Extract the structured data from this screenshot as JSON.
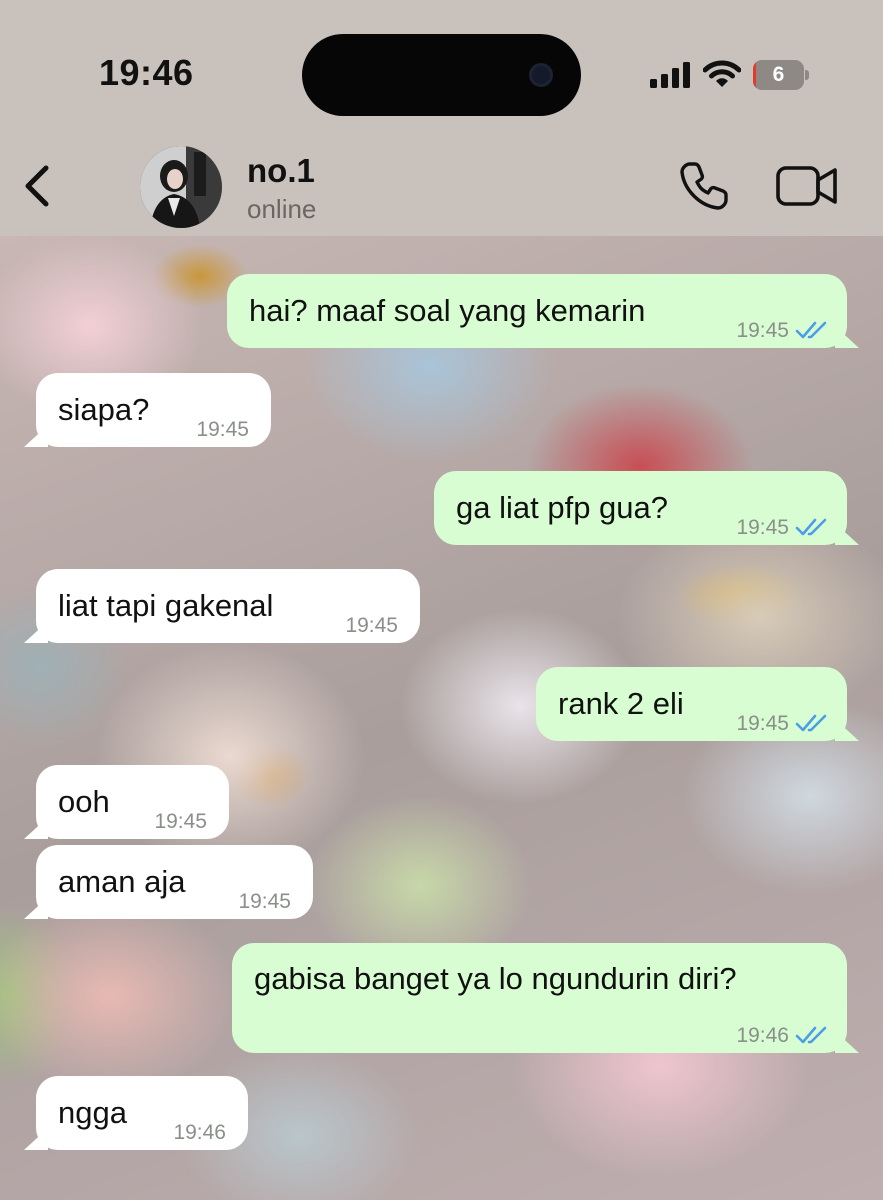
{
  "status_bar": {
    "time": "19:46",
    "battery_level": "6",
    "battery_color": "#e23b2e",
    "signal_icon": "cellular-signal-icon",
    "wifi_icon": "wifi-icon"
  },
  "header": {
    "back_icon": "chevron-left-icon",
    "contact_name": "no.1",
    "contact_status": "online",
    "call_icon": "phone-icon",
    "video_icon": "video-camera-icon"
  },
  "colors": {
    "outgoing_bubble": "#d9fdd3",
    "incoming_bubble": "#ffffff",
    "read_ticks": "#4a9ee8"
  },
  "messages": [
    {
      "direction": "outgoing",
      "text": "hai? maaf soal yang kemarin",
      "time": "19:45",
      "status": "read"
    },
    {
      "direction": "incoming",
      "text": "siapa?",
      "time": "19:45"
    },
    {
      "direction": "outgoing",
      "text": "ga liat pfp gua?",
      "time": "19:45",
      "status": "read"
    },
    {
      "direction": "incoming",
      "text": "liat tapi gakenal",
      "time": "19:45"
    },
    {
      "direction": "outgoing",
      "text": "rank 2 eli",
      "time": "19:45",
      "status": "read"
    },
    {
      "direction": "incoming",
      "text": "ooh",
      "time": "19:45"
    },
    {
      "direction": "incoming",
      "text": "aman aja",
      "time": "19:45"
    },
    {
      "direction": "outgoing",
      "text": "gabisa banget ya lo ngundurin diri?",
      "time": "19:46",
      "status": "read"
    },
    {
      "direction": "incoming",
      "text": "ngga",
      "time": "19:46"
    }
  ]
}
